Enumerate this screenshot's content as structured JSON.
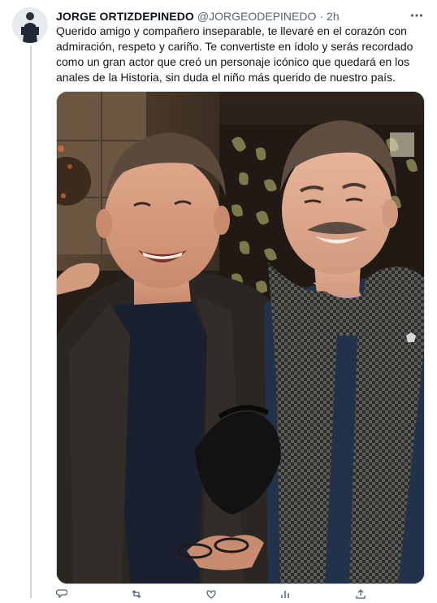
{
  "tweet": {
    "display_name": "JORGE ORTIZDEPINEDO",
    "handle": "@JORGEODEPINEDO",
    "separator": "·",
    "time": "2h",
    "text": "Querido amigo y compañero inseparable, te llevaré en el corazón con\nadmiración, respeto y cariño. Te convertiste en ídolo y serás recordado\ncomo un gran actor que creó un personaje icónico que quedará en los\nanales de la Historia, sin duda el niño más querido de nuestro país."
  },
  "icons": {
    "more": "more-horizontal-icon",
    "reply": "reply-icon",
    "retweet": "retweet-icon",
    "like": "like-icon",
    "views": "views-icon",
    "share": "share-icon"
  },
  "colors": {
    "text": "#0f1419",
    "secondary": "#536471",
    "border": "#cfd9de"
  }
}
